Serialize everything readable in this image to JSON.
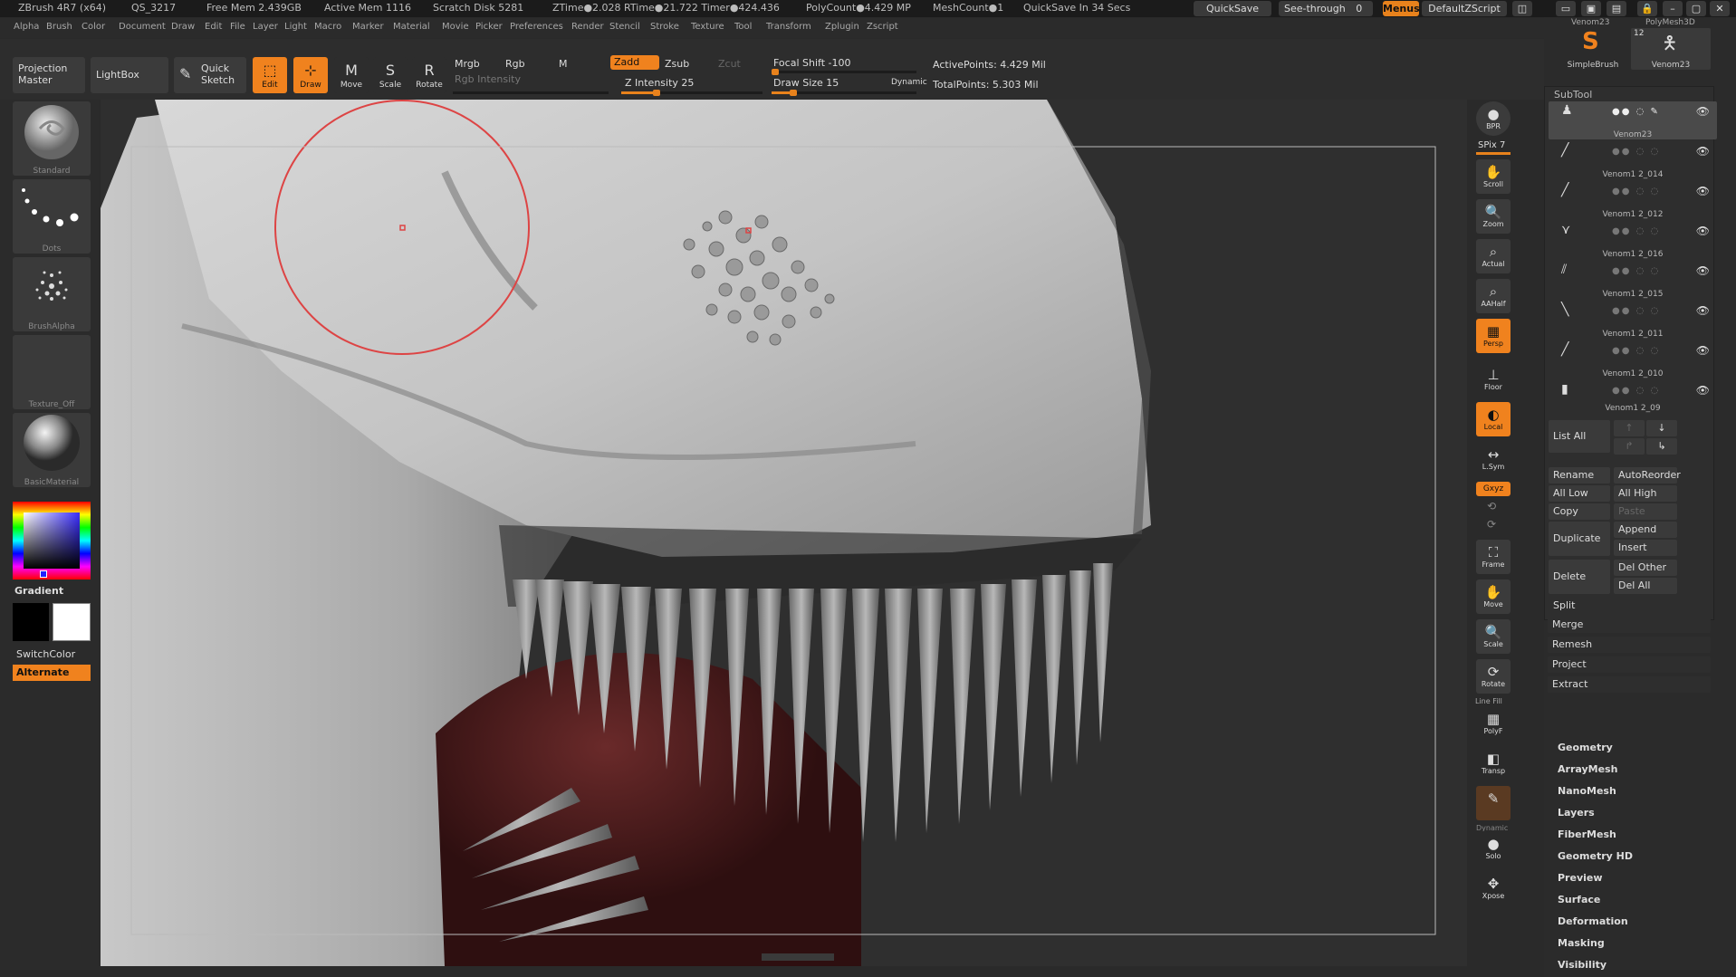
{
  "status": {
    "app": "ZBrush 4R7 (x64)",
    "qs": "QS_3217",
    "free_mem": "Free Mem 2.439GB",
    "active_mem": "Active Mem 1116",
    "scratch": "Scratch Disk 5281",
    "ztime": "ZTime●2.028 RTime●21.722 Timer●424.436",
    "polycount": "PolyCount●4.429 MP",
    "meshcount": "MeshCount●1",
    "quicksave_timer": "QuickSave In 34 Secs",
    "quicksave_btn": "QuickSave",
    "seethrough": "See-through",
    "seethrough_val": "0",
    "menus_btn": "Menus",
    "script_btn": "DefaultZScript"
  },
  "menu": [
    "Alpha",
    "Brush",
    "Color",
    "Document",
    "Draw",
    "Edit",
    "File",
    "Layer",
    "Light",
    "Macro",
    "Marker",
    "Material",
    "Movie",
    "Picker",
    "Preferences",
    "Render",
    "Stencil",
    "Stroke",
    "Texture",
    "Tool",
    "Transform",
    "Zplugin",
    "Zscript"
  ],
  "toolbar": {
    "projection_master": "Projection Master",
    "lightbox": "LightBox",
    "quick_sketch": "Quick Sketch",
    "edit": "Edit",
    "draw": "Draw",
    "move": "Move",
    "scale": "Scale",
    "rotate": "Rotate",
    "mrgb": "Mrgb",
    "rgb": "Rgb",
    "m": "M",
    "zadd": "Zadd",
    "zsub": "Zsub",
    "zcut": "Zcut",
    "rgb_intensity": "Rgb Intensity",
    "z_intensity": "Z Intensity 25",
    "focal_shift": "Focal Shift -100",
    "draw_size": "Draw Size 15",
    "dynamic": "Dynamic",
    "active_points": "ActivePoints: 4.429 Mil",
    "total_points": "TotalPoints: 5.303 Mil",
    "z_intensity_level": 0.25,
    "focal_shift_level": 0.0,
    "draw_size_level": 0.15
  },
  "left": {
    "standard": "Standard",
    "dots": "Dots",
    "brushalpha": "BrushAlpha",
    "texture_off": "Texture_Off",
    "basic_material": "BasicMaterial",
    "gradient": "Gradient",
    "switchcolor": "SwitchColor",
    "alternate": "Alternate",
    "accent": "#f0821e"
  },
  "dock": {
    "bpr": "BPR",
    "spix": "SPix 7",
    "scroll": "Scroll",
    "zoom": "Zoom",
    "actual": "Actual",
    "aahalf": "AAHalf",
    "persp": "Persp",
    "floor": "Floor",
    "local": "Local",
    "lsym": "L.Sym",
    "xyz": "Gxyz",
    "frame": "Frame",
    "move": "Move",
    "scale": "Scale",
    "rotate": "Rotate",
    "polyf": "PolyF",
    "linefill": "Line Fill",
    "transp": "Transp",
    "dynamic": "Dynamic",
    "solo": "Solo",
    "xpose": "Xpose"
  },
  "palette": {
    "top_left_name": "Venom23",
    "top_right_name": "PolyMesh3D",
    "simplebrush": "SimpleBrush",
    "venom_tool": "Venom23",
    "venom_count": "12",
    "subtool_title": "SubTool",
    "subtools": [
      "Venom23",
      "Venom1 2_014",
      "Venom1 2_012",
      "Venom1 2_016",
      "Venom1 2_015",
      "Venom1 2_011",
      "Venom1 2_010",
      "Venom1 2_09"
    ],
    "list_all": "List All",
    "rename": "Rename",
    "autoreorder": "AutoReorder",
    "all_low": "All Low",
    "all_high": "All High",
    "copy": "Copy",
    "paste": "Paste",
    "duplicate": "Duplicate",
    "append": "Append",
    "insert": "Insert",
    "delete": "Delete",
    "del_other": "Del Other",
    "del_all": "Del All",
    "split": "Split",
    "merge": "Merge",
    "remesh": "Remesh",
    "project": "Project",
    "extract": "Extract",
    "sections": [
      "Geometry",
      "ArrayMesh",
      "NanoMesh",
      "Layers",
      "FiberMesh",
      "Geometry HD",
      "Preview",
      "Surface",
      "Deformation",
      "Masking",
      "Visibility"
    ]
  }
}
